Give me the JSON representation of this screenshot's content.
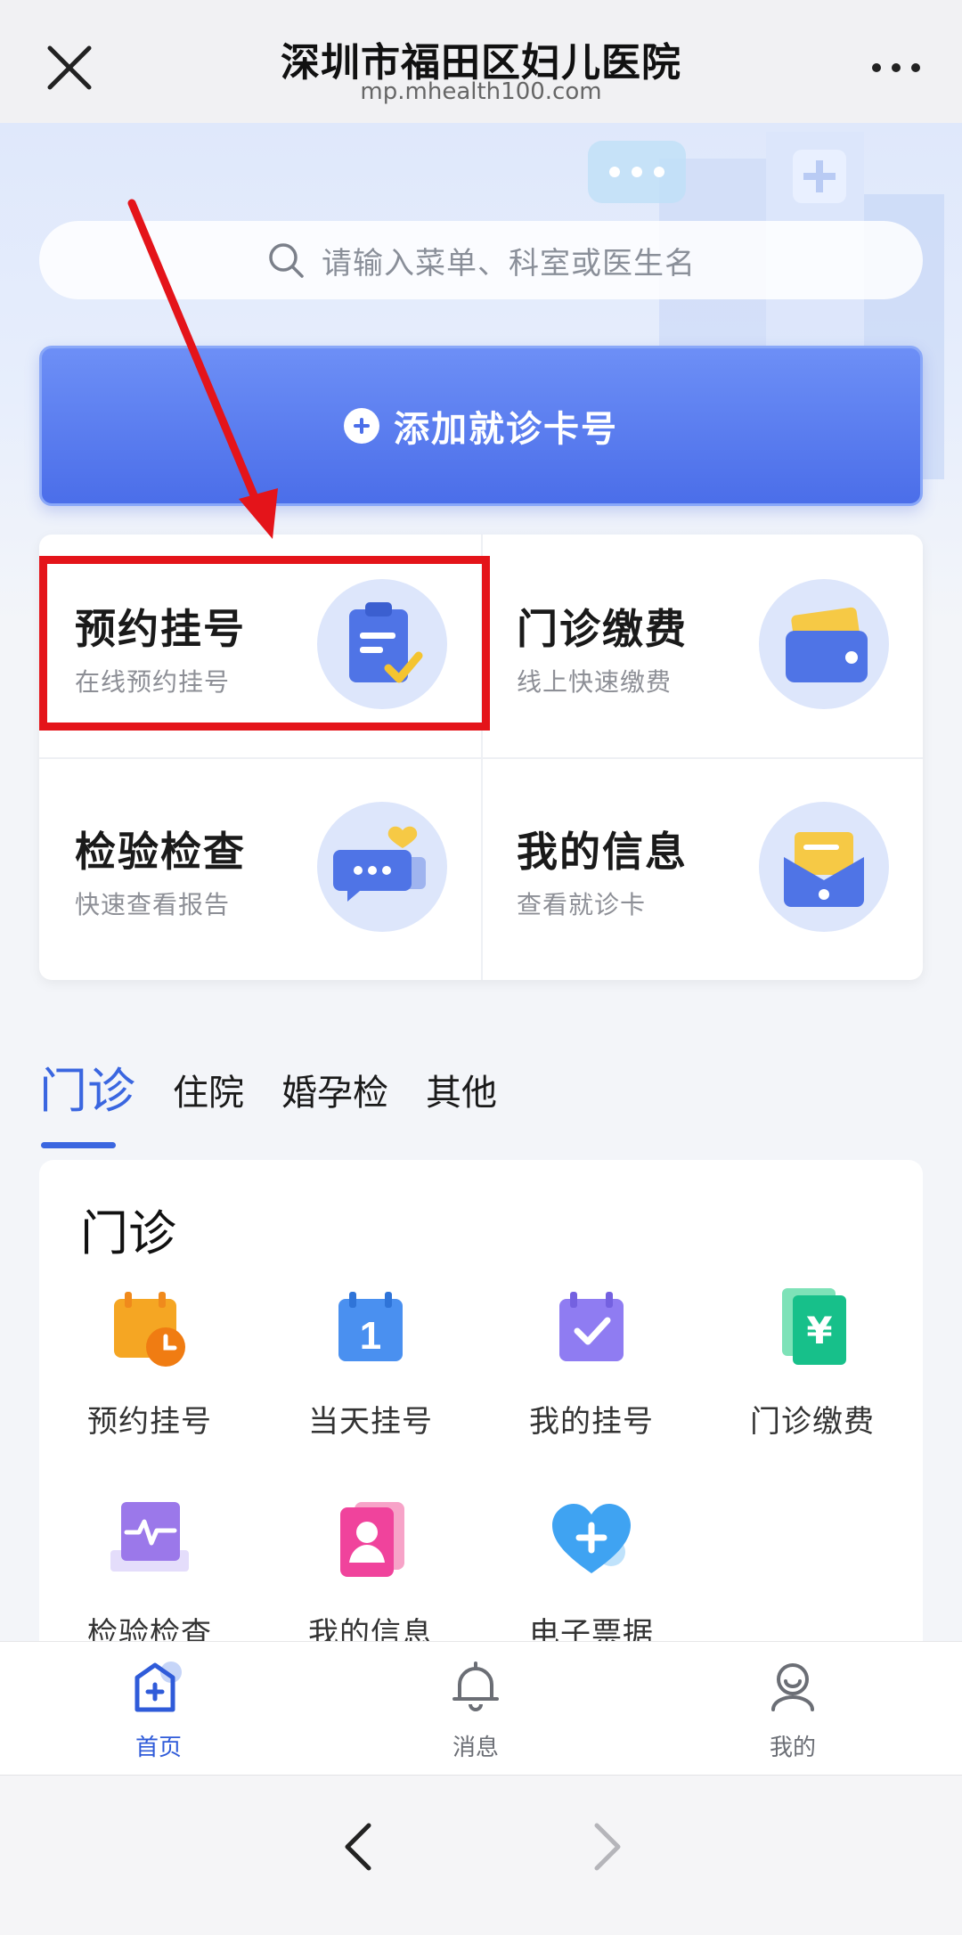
{
  "topbar": {
    "title": "深圳市福田区妇儿医院",
    "domain": "mp.mhealth100.com",
    "icons": [
      "close-icon",
      "more-icon"
    ]
  },
  "search": {
    "placeholder": "请输入菜单、科室或医生名",
    "icon": "search-icon"
  },
  "add_card": {
    "label": "添加就诊卡号",
    "icon": "plus-icon"
  },
  "quick_actions": [
    {
      "title": "预约挂号",
      "subtitle": "在线预约挂号",
      "icon": "clipboard-check-icon"
    },
    {
      "title": "门诊缴费",
      "subtitle": "线上快速缴费",
      "icon": "wallet-icon"
    },
    {
      "title": "检验检查",
      "subtitle": "快速查看报告",
      "icon": "chat-report-icon"
    },
    {
      "title": "我的信息",
      "subtitle": "查看就诊卡",
      "icon": "envelope-card-icon"
    }
  ],
  "tabs": [
    "门诊",
    "住院",
    "婚孕检",
    "其他"
  ],
  "active_tab": "门诊",
  "panel": {
    "title": "门诊",
    "services": [
      {
        "label": "预约挂号",
        "icon": "calendar-clock-icon"
      },
      {
        "label": "当天挂号",
        "icon": "calendar-day-icon"
      },
      {
        "label": "我的挂号",
        "icon": "calendar-check-icon"
      },
      {
        "label": "门诊缴费",
        "icon": "yuan-payment-icon"
      },
      {
        "label": "检验检查",
        "icon": "pulse-monitor-icon"
      },
      {
        "label": "我的信息",
        "icon": "id-card-icon"
      },
      {
        "label": "电子票据",
        "icon": "heart-plus-icon"
      }
    ]
  },
  "bottom_nav": [
    {
      "label": "首页",
      "icon": "home-hospital-icon",
      "active": true
    },
    {
      "label": "消息",
      "icon": "bell-icon",
      "active": false
    },
    {
      "label": "我的",
      "icon": "user-icon",
      "active": false
    }
  ],
  "browser": {
    "icons": [
      "back-icon",
      "forward-icon"
    ]
  },
  "colors": {
    "accent": "#3a66e0",
    "annotation": "#e4141a",
    "button_blue": "#4b6ee9"
  }
}
